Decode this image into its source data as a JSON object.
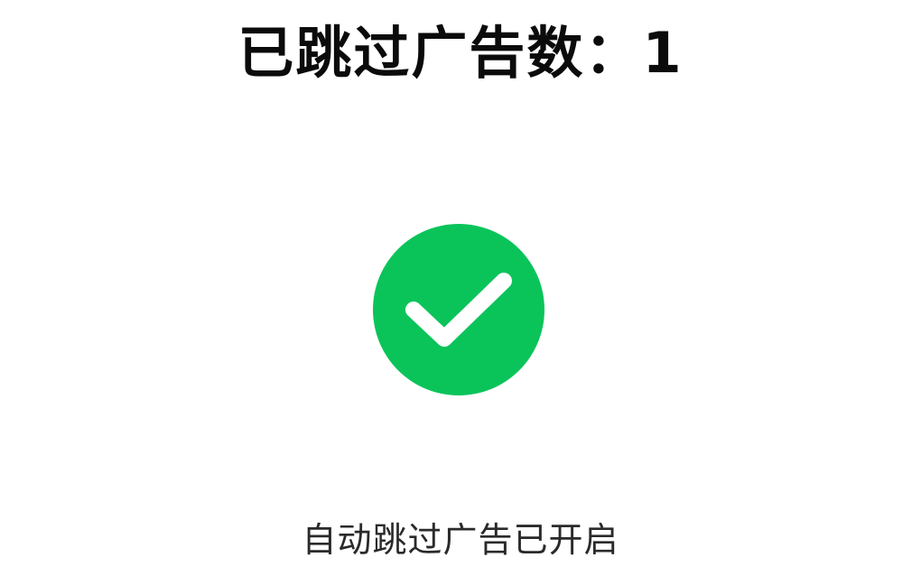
{
  "counter": {
    "label": "已跳过广告数：",
    "count": "1"
  },
  "status": {
    "icon": "check-circle-icon",
    "color": "#0ac45a",
    "text": "自动跳过广告已开启"
  }
}
